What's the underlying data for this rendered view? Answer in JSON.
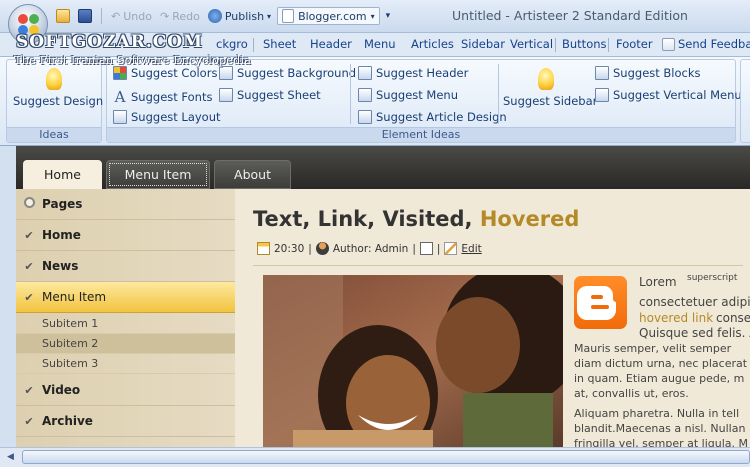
{
  "window": {
    "title": "Untitled - Artisteer 2 Standard Edition"
  },
  "watermark": {
    "line1": "SOFTGOZAR.COM",
    "line2": "The First Iranian Software Encyclopedia"
  },
  "qat": {
    "undo": "Undo",
    "redo": "Redo",
    "publish": "Publish",
    "target": "Blogger.com"
  },
  "tabs": [
    "ckgro",
    "Sheet",
    "Header",
    "Menu",
    "Articles",
    "Sidebar",
    "Vertical",
    "Buttons",
    "Footer",
    "Send Feedback"
  ],
  "ribbon": {
    "ideas_group": {
      "button": "Suggest Design",
      "label": "Ideas"
    },
    "element_group": {
      "label": "Element Ideas",
      "col1": [
        "Suggest Colors",
        "Suggest Fonts",
        "Suggest Layout"
      ],
      "col2": [
        "Suggest Background",
        "Suggest Sheet"
      ],
      "col3": [
        "Suggest Header",
        "Suggest Menu",
        "Suggest Article Design"
      ],
      "sidebar_button": "Suggest Sidebar",
      "col4": [
        "Suggest Blocks",
        "Suggest Vertical Menu"
      ]
    }
  },
  "site": {
    "nav": [
      "Home",
      "Menu Item",
      "About"
    ],
    "vmenu": [
      "Pages",
      "Home",
      "News",
      "Menu Item",
      "Video",
      "Archive"
    ],
    "subitems": [
      "Subitem 1",
      "Subitem 2",
      "Subitem 3"
    ],
    "post": {
      "title_parts": [
        "Text, ",
        "Link, ",
        "Visited, ",
        "Hovered"
      ],
      "time": "20:30",
      "author": "Author: Admin",
      "edit": "Edit",
      "text_lines": [
        "Lorem",
        "superscript",
        "consectetuer adipis",
        "hovered link",
        "conse",
        "Quisque sed felis. A",
        "Mauris semper, velit semper",
        "diam dictum urna, nec placerat",
        "in quam. Etiam augue pede, m",
        "at, convallis ut, eros.",
        "Aliquam pharetra. Nulla in tell",
        "blandit.Maecenas a nisl. Nullan",
        "fringilla vel, semper at ligula. M"
      ]
    }
  },
  "colors": {
    "hover": "#b38a27",
    "accent_orange": "#f26b0a",
    "ribbon_text": "#15428b"
  }
}
